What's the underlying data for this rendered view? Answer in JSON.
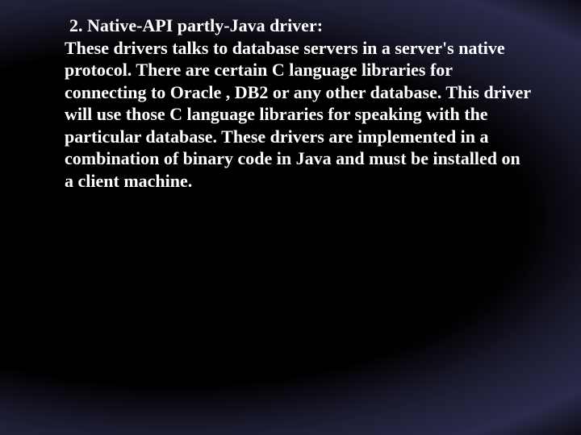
{
  "slide": {
    "heading": " 2. Native-API partly-Java driver:",
    "body": "These drivers  talks to database servers in a server's native protocol. There are certain C language libraries for connecting to Oracle , DB2 or any other database. This driver will use those C language libraries for speaking with the particular database. These drivers are implemented in a combination of binary code in Java and must be installed on a client machine."
  }
}
